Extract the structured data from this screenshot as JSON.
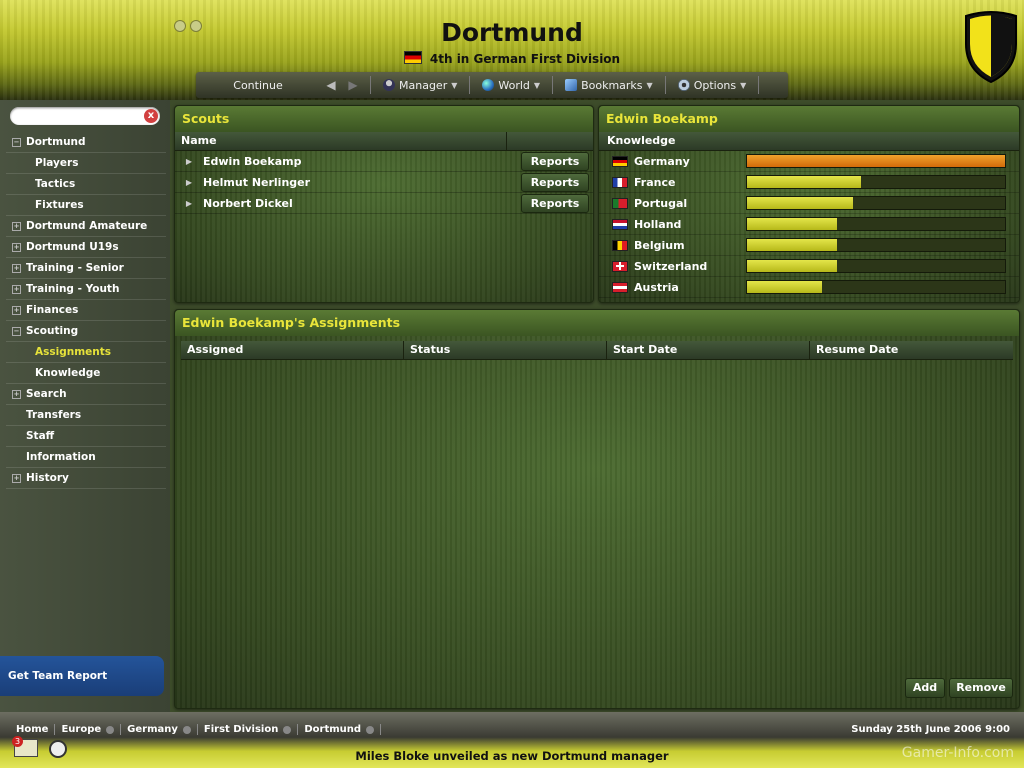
{
  "header": {
    "club_name": "Dortmund",
    "subtitle": "4th in German First Division"
  },
  "nav": {
    "continue": "Continue",
    "items": [
      {
        "label": "Manager",
        "icon": "manager-icon"
      },
      {
        "label": "World",
        "icon": "globe-icon"
      },
      {
        "label": "Bookmarks",
        "icon": "bookmark-icon"
      },
      {
        "label": "Options",
        "icon": "gear-icon"
      }
    ]
  },
  "search": {
    "placeholder": "",
    "clear_icon": "close-icon"
  },
  "sidebar": {
    "items": [
      {
        "label": "Dortmund",
        "level": 0,
        "expander": "−"
      },
      {
        "label": "Players",
        "level": 1
      },
      {
        "label": "Tactics",
        "level": 1
      },
      {
        "label": "Fixtures",
        "level": 1
      },
      {
        "label": "Dortmund Amateure",
        "level": 0,
        "expander": "+"
      },
      {
        "label": "Dortmund U19s",
        "level": 0,
        "expander": "+"
      },
      {
        "label": "Training - Senior",
        "level": 0,
        "expander": "+"
      },
      {
        "label": "Training - Youth",
        "level": 0,
        "expander": "+"
      },
      {
        "label": "Finances",
        "level": 0,
        "expander": "+"
      },
      {
        "label": "Scouting",
        "level": 0,
        "expander": "−"
      },
      {
        "label": "Assignments",
        "level": 1,
        "selected": true
      },
      {
        "label": "Knowledge",
        "level": 1
      },
      {
        "label": "Search",
        "level": 0,
        "expander": "+"
      },
      {
        "label": "Transfers",
        "level": 0
      },
      {
        "label": "Staff",
        "level": 0
      },
      {
        "label": "Information",
        "level": 0
      },
      {
        "label": "History",
        "level": 0,
        "expander": "+"
      }
    ],
    "team_report": "Get Team Report"
  },
  "scouts": {
    "title": "Scouts",
    "column": "Name",
    "reports_label": "Reports",
    "rows": [
      "Edwin Boekamp",
      "Helmut Nerlinger",
      "Norbert Dickel"
    ]
  },
  "knowledge": {
    "title": "Edwin Boekamp",
    "column": "Knowledge",
    "rows": [
      {
        "country": "Germany",
        "level": 1.0,
        "flag": [
          "#000000",
          "#dd0000",
          "#ffcc00"
        ]
      },
      {
        "country": "France",
        "level": 0.44,
        "flag": [
          "#1f3fa8",
          "#ffffff",
          "#d81e2c"
        ]
      },
      {
        "country": "Portugal",
        "level": 0.41,
        "flag": [
          "#1a7a2a",
          "#d81e2c",
          "#d81e2c"
        ]
      },
      {
        "country": "Holland",
        "level": 0.35,
        "flag": [
          "#c8102e",
          "#ffffff",
          "#1f3fa8"
        ]
      },
      {
        "country": "Belgium",
        "level": 0.35,
        "flag": [
          "#000000",
          "#ffd200",
          "#e11b22"
        ]
      },
      {
        "country": "Switzerland",
        "level": 0.35,
        "flag": [
          "#d81e2c",
          "#d81e2c",
          "#d81e2c"
        ]
      },
      {
        "country": "Austria",
        "level": 0.29,
        "flag": [
          "#d81e2c",
          "#ffffff",
          "#d81e2c"
        ]
      }
    ]
  },
  "assignments": {
    "title": "Edwin Boekamp's Assignments",
    "columns": [
      "Assigned",
      "Status",
      "Start Date",
      "Resume Date"
    ],
    "add_label": "Add",
    "remove_label": "Remove"
  },
  "bottom": {
    "breadcrumbs": [
      "Home",
      "Europe",
      "Germany",
      "First Division",
      "Dortmund"
    ],
    "datetime": "Sunday 25th June 2006 9:00",
    "news": "Miles Bloke unveiled as new Dortmund manager",
    "mail_count": "3",
    "watermark": "Gamer-Info.com"
  },
  "colors": {
    "accent_yellow": "#e9e53a",
    "bar_yellow": "#d8da36",
    "bar_orange": "#e8861a"
  }
}
